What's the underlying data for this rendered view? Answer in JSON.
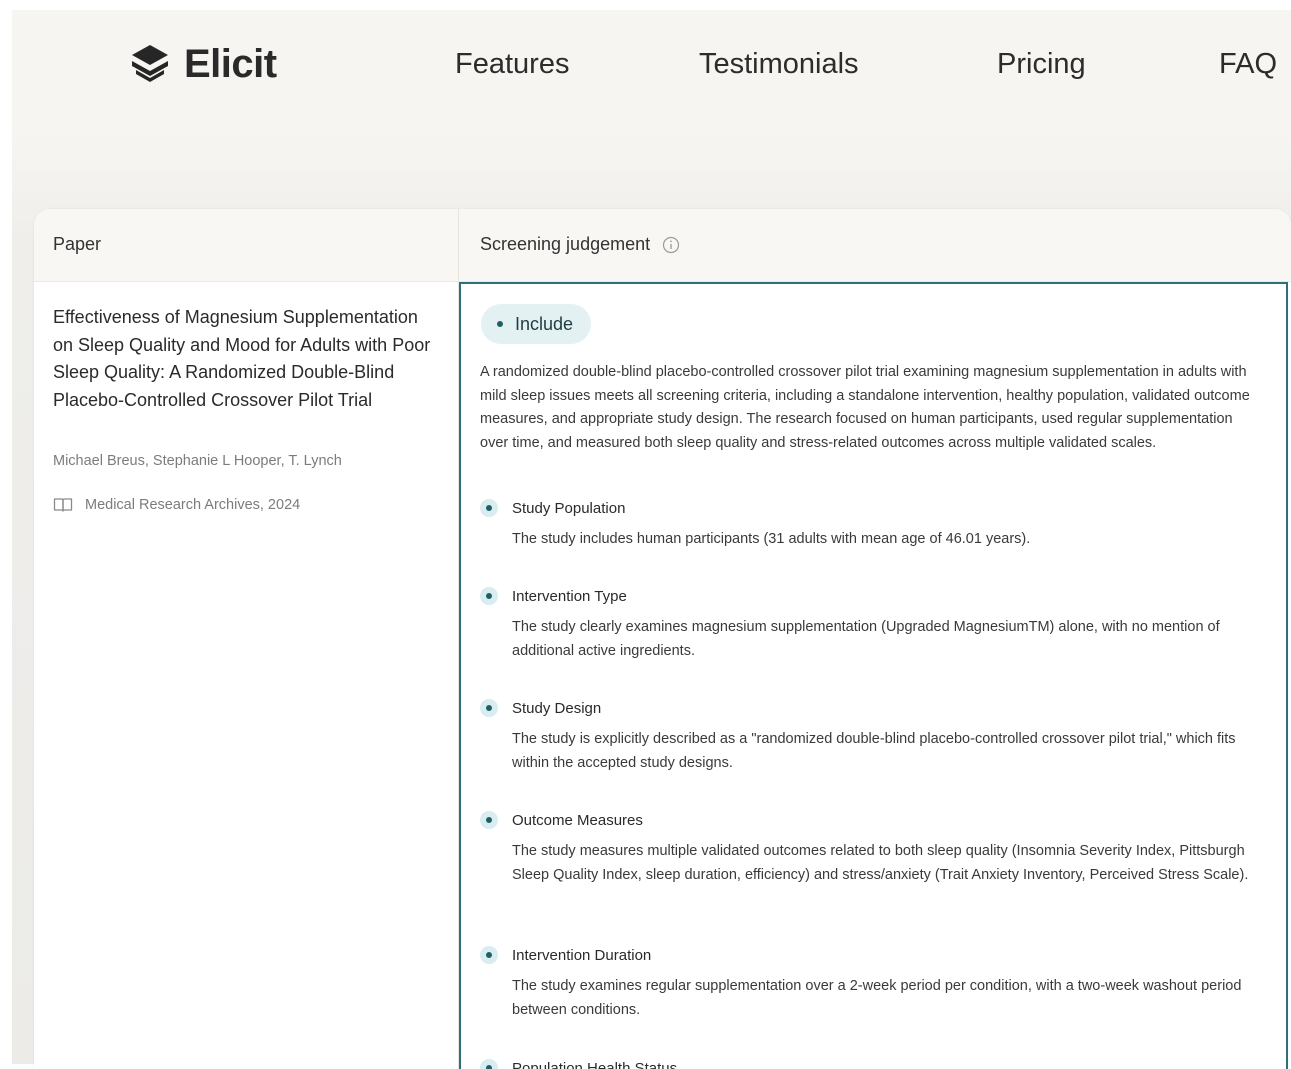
{
  "nav": {
    "brand": "Elicit",
    "links": [
      "Features",
      "Testimonials",
      "Pricing",
      "FAQ"
    ]
  },
  "table": {
    "headers": {
      "paper": "Paper",
      "screening": "Screening judgement"
    },
    "paper": {
      "title": "Effectiveness of Magnesium Supplementation on Sleep Quality and Mood for Adults with Poor Sleep Quality: A Randomized Double-Blind Placebo-Controlled Crossover Pilot Trial",
      "authors": "Michael Breus, Stephanie L Hooper, T. Lynch",
      "journal": "Medical Research Archives, 2024"
    },
    "judgement": {
      "verdict": "Include",
      "summary": "A randomized double-blind placebo-controlled crossover pilot trial examining magnesium supplementation in adults with mild sleep issues meets all screening criteria, including a standalone intervention, healthy population, validated outcome measures, and appropriate study design. The research focused on human participants, used regular supplementation over time, and measured both sleep quality and stress-related outcomes across multiple validated scales.",
      "criteria": [
        {
          "name": "Study Population",
          "text": "The study includes human participants (31 adults with mean age of 46.01 years)."
        },
        {
          "name": "Intervention Type",
          "text": "The study clearly examines magnesium supplementation (Upgraded MagnesiumTM) alone, with no mention of additional active ingredients."
        },
        {
          "name": "Study Design",
          "text": "The study is explicitly described as a \"randomized double-blind placebo-controlled crossover pilot trial,\" which fits within the accepted study designs."
        },
        {
          "name": "Outcome Measures",
          "text": "The study measures multiple validated outcomes related to both sleep quality (Insomnia Severity Index, Pittsburgh Sleep Quality Index, sleep duration, efficiency) and stress/anxiety (Trait Anxiety Inventory, Perceived Stress Scale)."
        },
        {
          "name": "Intervention Duration",
          "text": "The study examines regular supplementation over a 2-week period per condition, with a two-week washout period between conditions."
        },
        {
          "name": "Population Health Status",
          "text": ""
        }
      ]
    }
  },
  "colors": {
    "accent": "#2e6f78",
    "pill_bg": "#e3f1f3",
    "dot": "#1f5f66"
  }
}
